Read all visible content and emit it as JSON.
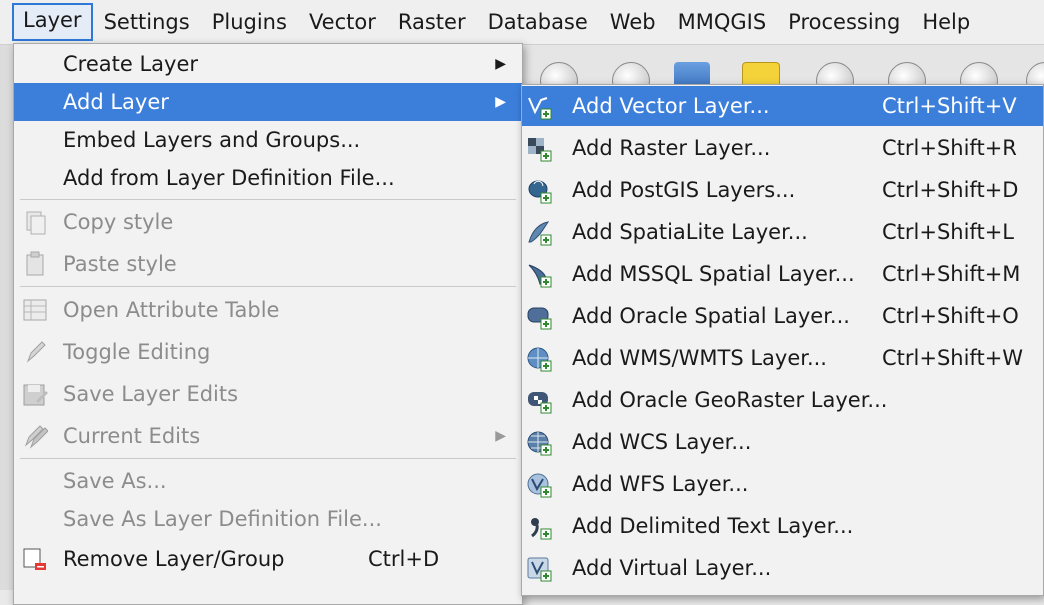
{
  "menubar": [
    "Layer",
    "Settings",
    "Plugins",
    "Vector",
    "Raster",
    "Database",
    "Web",
    "MMQGIS",
    "Processing",
    "Help"
  ],
  "layer_menu": {
    "create_layer": "Create Layer",
    "add_layer": "Add Layer",
    "embed": "Embed Layers and Groups...",
    "add_from_def": "Add from Layer Definition File...",
    "copy_style": "Copy style",
    "paste_style": "Paste style",
    "open_attr": "Open Attribute Table",
    "toggle_edit": "Toggle Editing",
    "save_edits": "Save Layer Edits",
    "current_edits": "Current Edits",
    "save_as": "Save As...",
    "save_as_def": "Save As Layer Definition File...",
    "remove": "Remove Layer/Group",
    "remove_sc": "Ctrl+D"
  },
  "add_layer_menu": [
    {
      "label": "Add Vector Layer...",
      "shortcut": "Ctrl+Shift+V",
      "icon": "vector-layer-icon"
    },
    {
      "label": "Add Raster Layer...",
      "shortcut": "Ctrl+Shift+R",
      "icon": "raster-layer-icon"
    },
    {
      "label": "Add PostGIS Layers...",
      "shortcut": "Ctrl+Shift+D",
      "icon": "postgis-icon"
    },
    {
      "label": "Add SpatiaLite Layer...",
      "shortcut": "Ctrl+Shift+L",
      "icon": "spatialite-icon"
    },
    {
      "label": "Add MSSQL Spatial Layer...",
      "shortcut": "Ctrl+Shift+M",
      "icon": "mssql-icon"
    },
    {
      "label": "Add Oracle Spatial Layer...",
      "shortcut": "Ctrl+Shift+O",
      "icon": "oracle-icon"
    },
    {
      "label": "Add WMS/WMTS Layer...",
      "shortcut": "Ctrl+Shift+W",
      "icon": "wms-icon"
    },
    {
      "label": "Add Oracle GeoRaster Layer...",
      "shortcut": "",
      "icon": "georaster-icon"
    },
    {
      "label": "Add WCS Layer...",
      "shortcut": "",
      "icon": "wcs-icon"
    },
    {
      "label": "Add WFS Layer...",
      "shortcut": "",
      "icon": "wfs-icon"
    },
    {
      "label": "Add Delimited Text Layer...",
      "shortcut": "",
      "icon": "delimited-text-icon"
    },
    {
      "label": "Add Virtual Layer...",
      "shortcut": "",
      "icon": "virtual-layer-icon"
    }
  ],
  "colors": {
    "selection": "#3b7fdb",
    "disabled_text": "#8c8c8c",
    "add_badge": "#3aa03a"
  }
}
